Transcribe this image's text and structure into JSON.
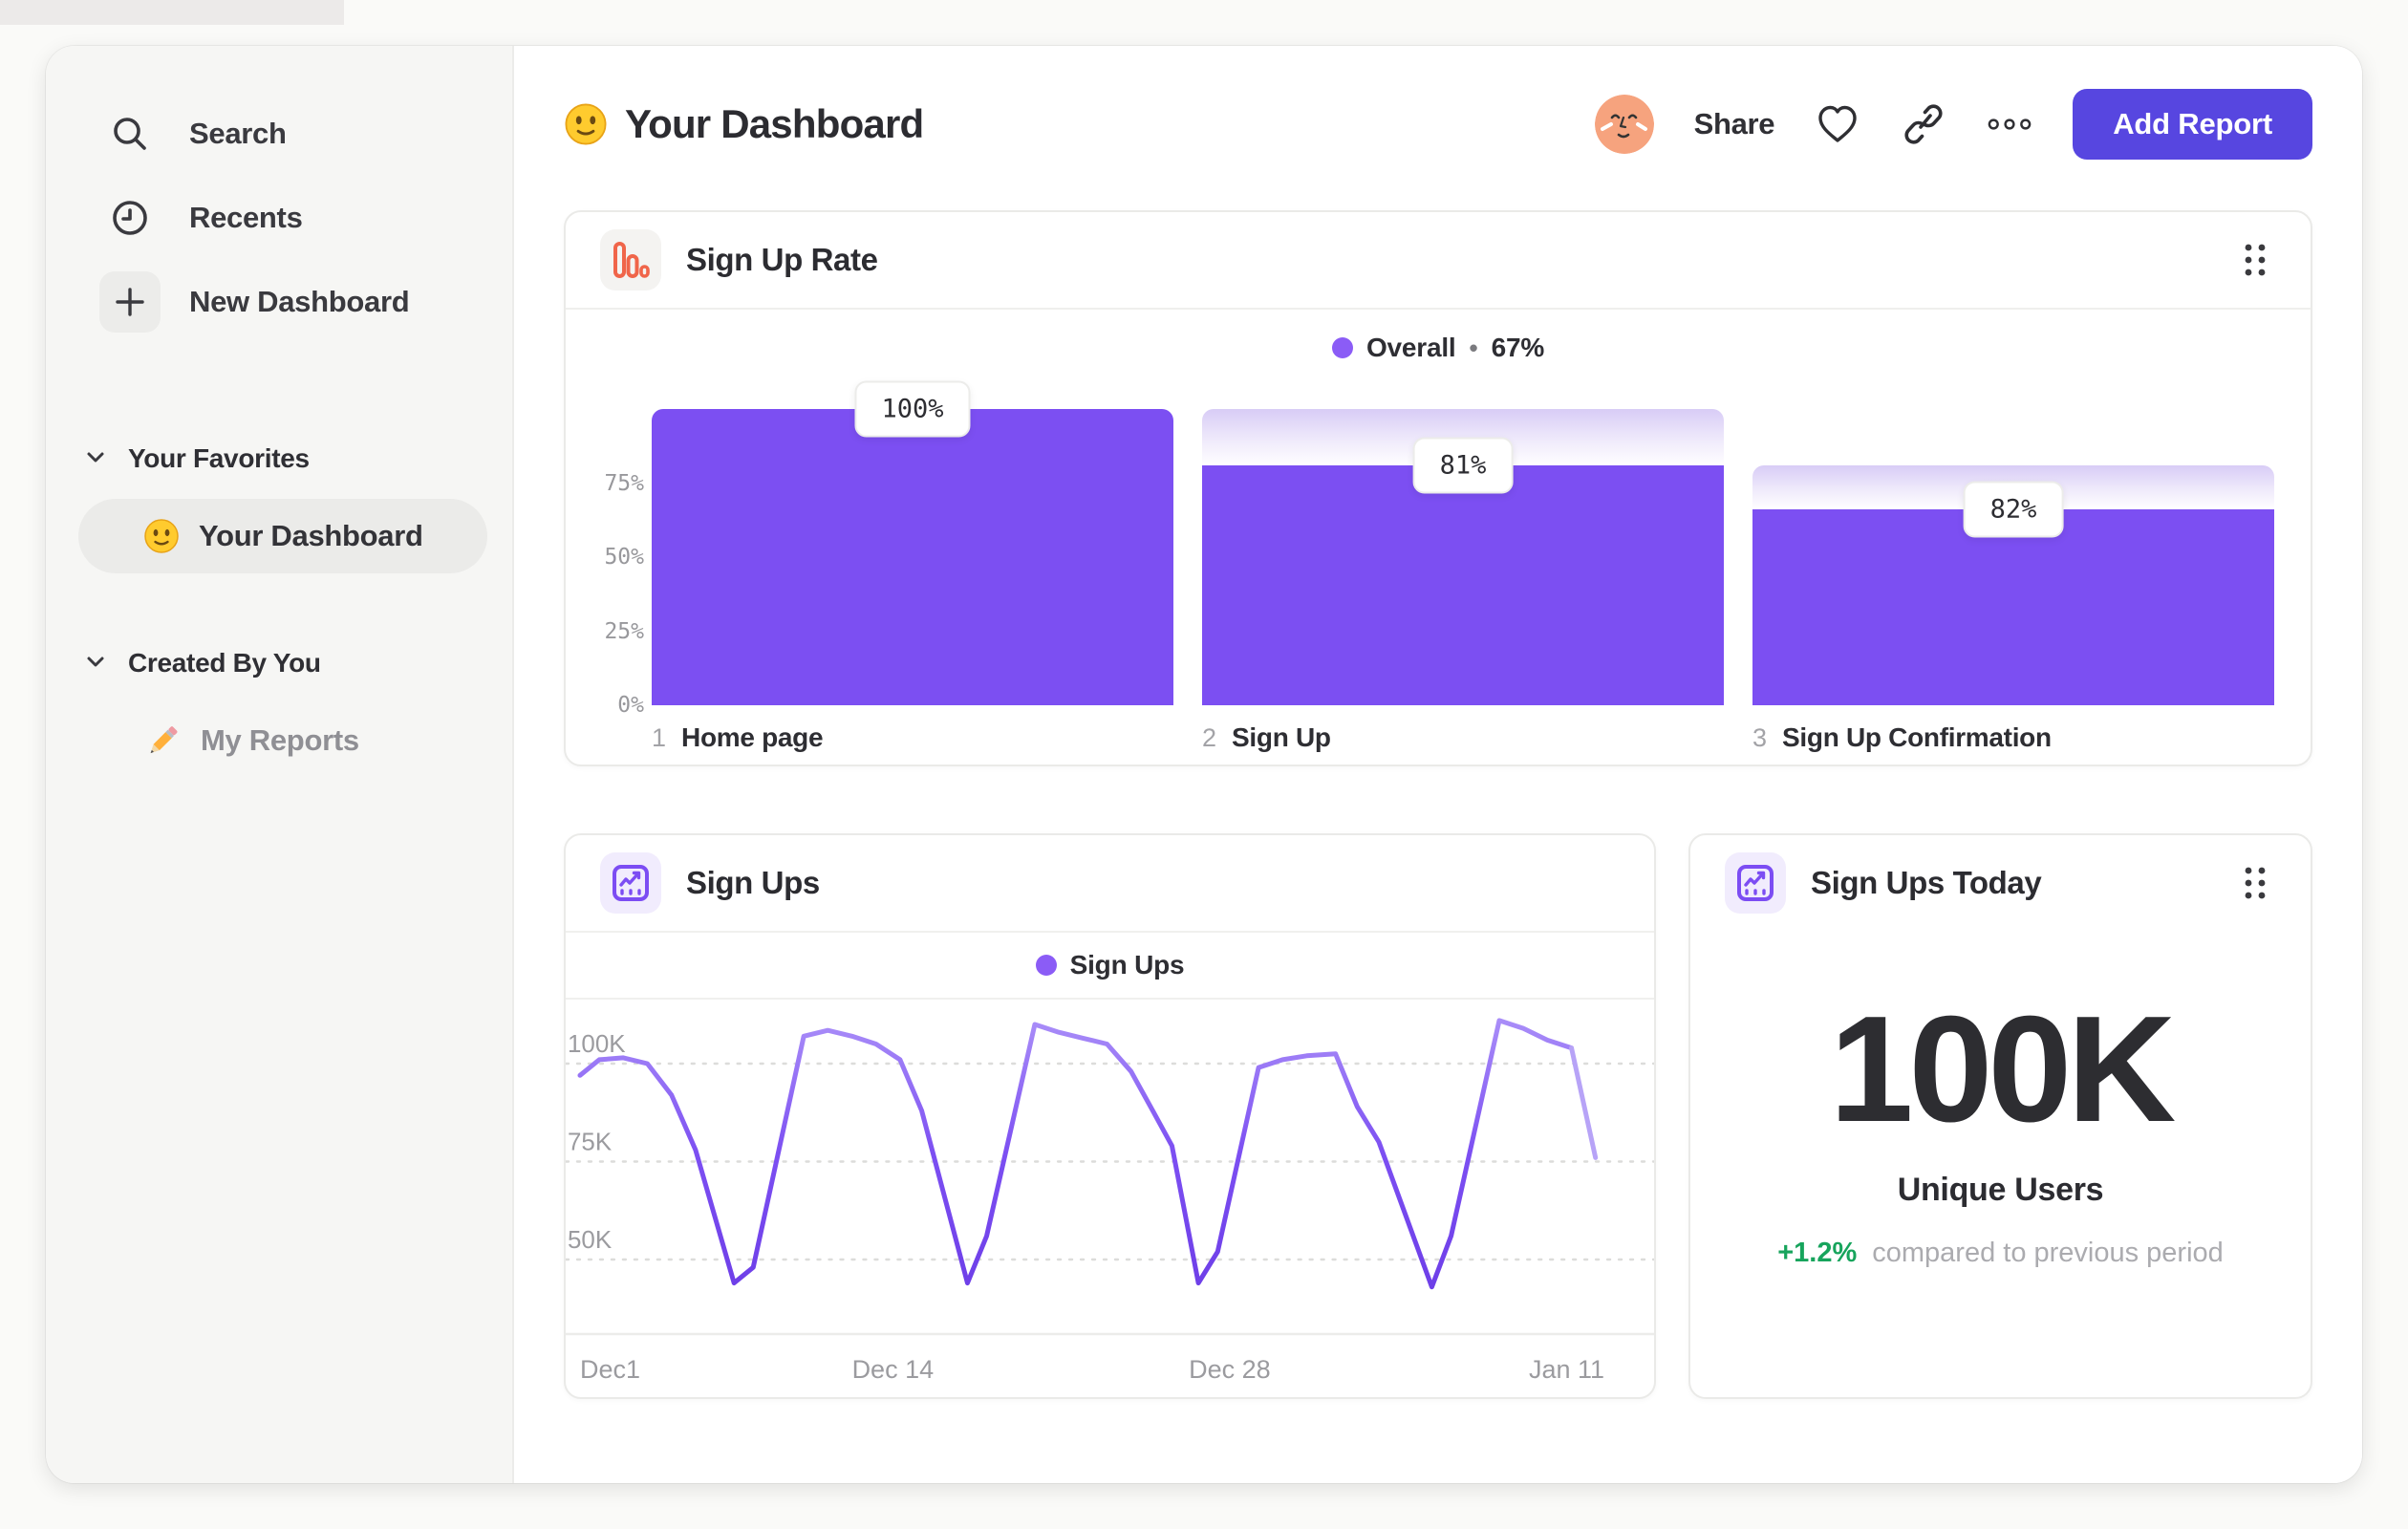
{
  "sidebar": {
    "nav": [
      {
        "label": "Search",
        "icon": "search-icon"
      },
      {
        "label": "Recents",
        "icon": "clock-icon"
      },
      {
        "label": "New Dashboard",
        "icon": "plus-icon"
      }
    ],
    "sections": [
      {
        "title": "Your Favorites",
        "items": [
          {
            "label": "Your Dashboard",
            "icon": "smiley-emoji",
            "selected": true
          }
        ]
      },
      {
        "title": "Created By You",
        "items": [
          {
            "label": "My Reports",
            "icon": "pencil-emoji",
            "selected": false
          }
        ]
      }
    ]
  },
  "header": {
    "title": "Your Dashboard",
    "actions": {
      "share": "Share",
      "add_report": "Add Report"
    }
  },
  "funnel_card": {
    "title": "Sign Up Rate",
    "legend_name": "Overall",
    "legend_sep": "•",
    "legend_value": "67%"
  },
  "line_card": {
    "title": "Sign Ups",
    "legend_name": "Sign Ups"
  },
  "stat_card": {
    "title": "Sign Ups Today",
    "value": "100K",
    "unit_label": "Unique Users",
    "delta": "+1.2%",
    "delta_note": "compared to previous period"
  },
  "chart_data": [
    {
      "type": "bar",
      "variant": "funnel",
      "title": "Sign Up Rate",
      "overall_conversion": "67%",
      "ylim": [
        0,
        100
      ],
      "y_ticks": [
        {
          "label": "75%",
          "value": 75
        },
        {
          "label": "50%",
          "value": 50
        },
        {
          "label": "25%",
          "value": 25
        },
        {
          "label": "0%",
          "value": 0
        }
      ],
      "steps": [
        {
          "num": "1",
          "label": "Home page",
          "conversion_label": "100%",
          "conversion_pct": 100,
          "absolute_pct": 100,
          "prev_absolute_pct": 100
        },
        {
          "num": "2",
          "label": "Sign Up",
          "conversion_label": "81%",
          "conversion_pct": 81,
          "absolute_pct": 81,
          "prev_absolute_pct": 100
        },
        {
          "num": "3",
          "label": "Sign Up Confirmation",
          "conversion_label": "82%",
          "conversion_pct": 82,
          "absolute_pct": 66,
          "prev_absolute_pct": 81
        }
      ]
    },
    {
      "type": "line",
      "title": "Sign Ups",
      "y_unit": "K unique users per day",
      "ylim": [
        40,
        115
      ],
      "x_range_days": [
        0,
        44
      ],
      "faded_from_day": 41.2,
      "y_ticks": [
        {
          "label": "100K",
          "value": 100
        },
        {
          "label": "75K",
          "value": 75
        },
        {
          "label": "50K",
          "value": 50
        }
      ],
      "x_ticks": [
        {
          "label": "Dec1",
          "day": 0
        },
        {
          "label": "Dec 14",
          "day": 13
        },
        {
          "label": "Dec 28",
          "day": 27
        },
        {
          "label": "Jan 11",
          "day": 41
        }
      ],
      "series": [
        {
          "name": "Sign Ups",
          "points": [
            [
              0,
              97
            ],
            [
              0.8,
              101
            ],
            [
              1.8,
              101.5
            ],
            [
              2.8,
              100
            ],
            [
              3.8,
              92
            ],
            [
              4.8,
              78
            ],
            [
              6.4,
              44
            ],
            [
              7.2,
              48
            ],
            [
              9.3,
              107
            ],
            [
              10.3,
              108.5
            ],
            [
              11.3,
              107
            ],
            [
              12.3,
              105
            ],
            [
              13.3,
              101
            ],
            [
              14.2,
              88
            ],
            [
              16.1,
              44
            ],
            [
              16.9,
              56
            ],
            [
              18.9,
              110
            ],
            [
              19.9,
              108
            ],
            [
              20.9,
              106.5
            ],
            [
              21.9,
              105
            ],
            [
              22.9,
              98
            ],
            [
              23.8,
              88
            ],
            [
              24.6,
              79
            ],
            [
              25.7,
              44
            ],
            [
              26.5,
              52
            ],
            [
              28.2,
              99
            ],
            [
              29.2,
              101
            ],
            [
              30.2,
              102
            ],
            [
              31.4,
              102.5
            ],
            [
              32.3,
              89
            ],
            [
              33.2,
              80
            ],
            [
              35.4,
              43
            ],
            [
              36.2,
              56
            ],
            [
              38.2,
              111
            ],
            [
              39.2,
              109
            ],
            [
              40.2,
              106
            ],
            [
              41.2,
              104
            ],
            [
              42.2,
              76
            ]
          ]
        }
      ]
    }
  ],
  "colors": {
    "accent_purple": "#7c4ff2",
    "accent_purple_light": "#a98df8",
    "legend_purple": "#8b5cf6",
    "button_purple": "#5746e0",
    "icon_orange": "#f0654a",
    "positive_green": "#17a45c",
    "grid_gray": "#dcdcda"
  }
}
